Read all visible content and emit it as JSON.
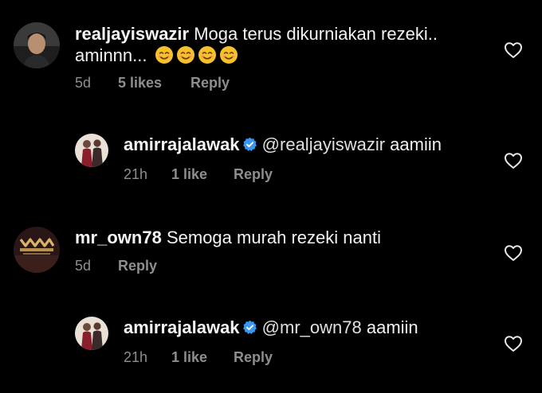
{
  "comments": [
    {
      "username": "realjayiswazir",
      "text_line1": "Moga terus dikurniakan rezeki..",
      "text_line2": "aminnn...",
      "emojis": [
        "smiling-face-emoji",
        "smiling-face-emoji",
        "smiling-face-emoji",
        "smiling-face-emoji"
      ],
      "time": "5d",
      "likes": "5 likes",
      "reply": "Reply"
    },
    {
      "username": "amirrajalawak",
      "verified": true,
      "mention": "@realjayiswazir",
      "text": "aamiin",
      "time": "21h",
      "likes": "1 like",
      "reply": "Reply"
    },
    {
      "username": "mr_own78",
      "text": "Semoga murah rezeki nanti",
      "time": "5d",
      "reply": "Reply"
    },
    {
      "username": "amirrajalawak",
      "verified": true,
      "mention": "@mr_own78",
      "text": "aamiin",
      "time": "21h",
      "likes": "1 like",
      "reply": "Reply"
    }
  ],
  "colors": {
    "background": "#000000",
    "text": "#f5f5f5",
    "meta": "#8e8e8e",
    "verified_badge": "#3897f0"
  },
  "icons": {
    "like": "heart-outline-icon",
    "verified": "verified-badge-icon"
  }
}
